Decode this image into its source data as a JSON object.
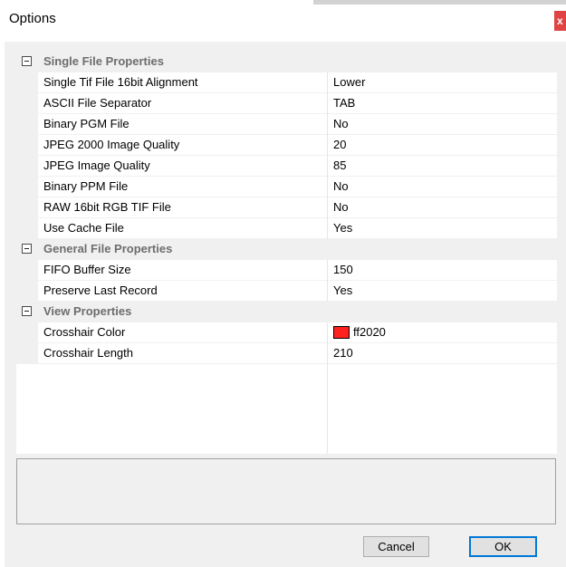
{
  "window": {
    "title": "Options",
    "close_label": "x"
  },
  "grid": {
    "categories": [
      {
        "name": "Single File Properties",
        "properties": [
          {
            "name": "Single Tif File 16bit Alignment",
            "value": "Lower"
          },
          {
            "name": "ASCII File Separator",
            "value": "TAB"
          },
          {
            "name": "Binary PGM File",
            "value": "No"
          },
          {
            "name": "JPEG 2000 Image Quality",
            "value": "20"
          },
          {
            "name": "JPEG Image Quality",
            "value": "85"
          },
          {
            "name": "Binary PPM File",
            "value": "No"
          },
          {
            "name": "RAW 16bit RGB TIF File",
            "value": "No"
          },
          {
            "name": "Use Cache File",
            "value": "Yes"
          }
        ]
      },
      {
        "name": "General File Properties",
        "properties": [
          {
            "name": "FIFO Buffer Size",
            "value": "150"
          },
          {
            "name": "Preserve Last Record",
            "value": "Yes"
          }
        ]
      },
      {
        "name": "View Properties",
        "properties": [
          {
            "name": "Crosshair Color",
            "value": "ff2020",
            "swatch": "#ff2020"
          },
          {
            "name": "Crosshair Length",
            "value": "210"
          }
        ]
      }
    ]
  },
  "buttons": {
    "cancel_label": "Cancel",
    "ok_label": "OK"
  }
}
